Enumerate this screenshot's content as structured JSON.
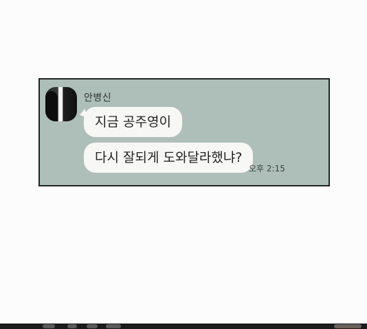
{
  "chat": {
    "sender_name": "안병신",
    "messages": [
      {
        "text": "지금 공주영이"
      },
      {
        "text": "다시 잘되게 도와달라했냐?"
      }
    ],
    "timestamp": "오후 2:15",
    "avatar_icon": "avatar-photo"
  },
  "colors": {
    "panel_background": "#aebfba",
    "bubble_background": "#f7f7f5",
    "page_background": "#fbfcfb"
  }
}
